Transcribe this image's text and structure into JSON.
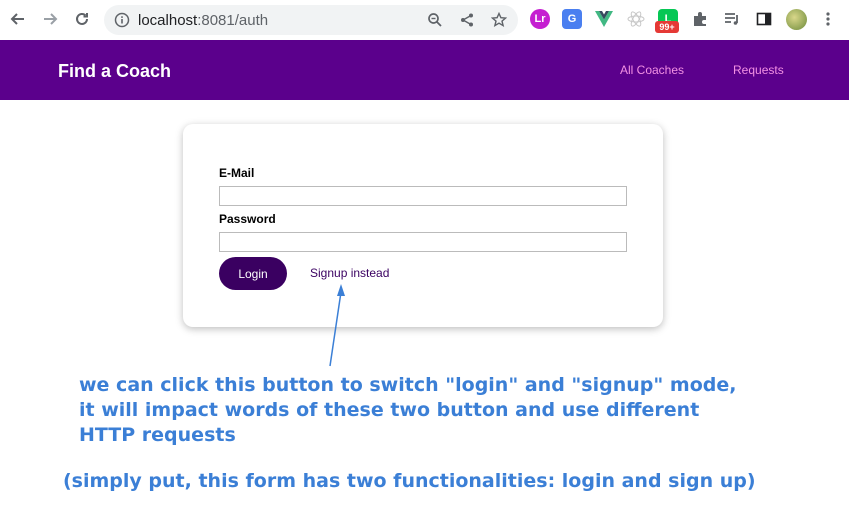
{
  "browser": {
    "url_host": "localhost",
    "url_rest": ":8081/auth",
    "icons": {
      "back": "back-arrow-icon",
      "forward": "forward-arrow-icon",
      "reload": "reload-icon",
      "info": "info-icon",
      "zoom": "zoom-icon",
      "share": "share-icon",
      "bookmark": "star-icon"
    },
    "extensions": {
      "badge_text": "99+"
    }
  },
  "app": {
    "brand": "Find a Coach",
    "nav": [
      {
        "label": "All Coaches"
      },
      {
        "label": "Requests"
      }
    ]
  },
  "form": {
    "email_label": "E-Mail",
    "email_value": "",
    "password_label": "Password",
    "password_value": "",
    "login_label": "Login",
    "switch_label": "Signup instead"
  },
  "annotation": {
    "line1": "we can click this button to switch \"login\" and \"signup\" mode,",
    "line2": "it will impact words of these two button and use different",
    "line3": "HTTP requests",
    "footnote": "(simply put, this form has two functionalities: login and sign up)"
  },
  "colors": {
    "header_bg": "#5b008c",
    "nav_link": "#f391e3",
    "button_bg": "#3a0061",
    "annotation": "#3b7fd6"
  }
}
